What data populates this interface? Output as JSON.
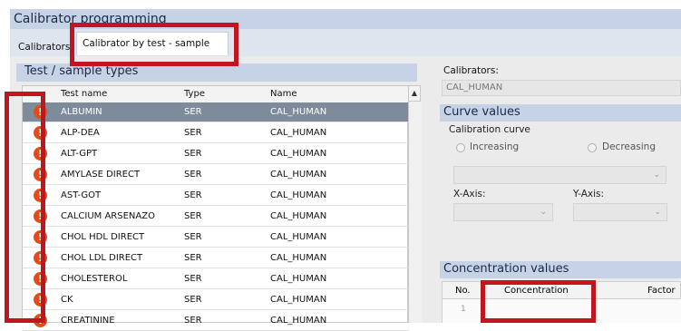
{
  "window": {
    "title": "Calibrator programming"
  },
  "tabs": [
    {
      "label": "Calibrators"
    },
    {
      "label": "Calibrator by test - sample"
    }
  ],
  "left_panel": {
    "title": "Test / sample types",
    "columns": [
      "Test name",
      "Type",
      "Name"
    ],
    "rows": [
      {
        "test": "ALBUMIN",
        "type": "SER",
        "name": "CAL_HUMAN",
        "selected": true
      },
      {
        "test": "ALP-DEA",
        "type": "SER",
        "name": "CAL_HUMAN"
      },
      {
        "test": "ALT-GPT",
        "type": "SER",
        "name": "CAL_HUMAN"
      },
      {
        "test": "AMYLASE DIRECT",
        "type": "SER",
        "name": "CAL_HUMAN"
      },
      {
        "test": "AST-GOT",
        "type": "SER",
        "name": "CAL_HUMAN"
      },
      {
        "test": "CALCIUM ARSENAZO",
        "type": "SER",
        "name": "CAL_HUMAN"
      },
      {
        "test": "CHOL HDL DIRECT",
        "type": "SER",
        "name": "CAL_HUMAN"
      },
      {
        "test": "CHOL LDL DIRECT",
        "type": "SER",
        "name": "CAL_HUMAN"
      },
      {
        "test": "CHOLESTEROL",
        "type": "SER",
        "name": "CAL_HUMAN"
      },
      {
        "test": "CK",
        "type": "SER",
        "name": "CAL_HUMAN"
      },
      {
        "test": "CREATININE",
        "type": "SER",
        "name": "CAL_HUMAN"
      }
    ],
    "status_icon": "warning-icon",
    "scroll_up": "▲"
  },
  "right_panel": {
    "calibrators_label": "Calibrators:",
    "calibrators_value": "CAL_HUMAN",
    "curve_title": "Curve values",
    "calibration_curve_label": "Calibration curve",
    "increasing_label": "Increasing",
    "decreasing_label": "Decreasing",
    "x_axis_label": "X-Axis:",
    "y_axis_label": "Y-Axis:",
    "concentration_title": "Concentration values",
    "conc_columns": [
      "No.",
      "Concentration",
      "Factor"
    ],
    "conc_first_row_no": "1"
  },
  "colors": {
    "highlight": "#c1161f",
    "selected_row": "#7d8b9a",
    "header": "#c6d3e7"
  }
}
